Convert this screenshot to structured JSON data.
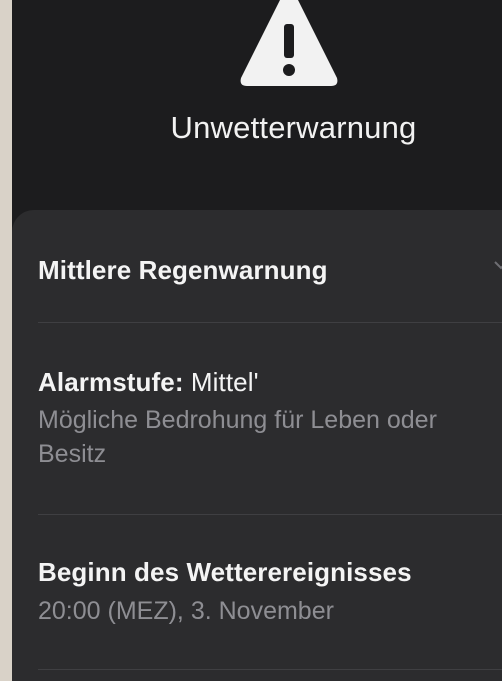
{
  "header": {
    "title": "Unwetterwarnung",
    "icon": "warning-triangle-icon"
  },
  "alert": {
    "name": "Mittlere Regenwarnung",
    "level_label": "Alarmstufe:",
    "level_value": " Mittel'",
    "level_description": "Mögliche Bedrohung für Leben oder Besitz",
    "start_label": "Beginn des Wetterereignisses",
    "start_value": "20:00 (MEZ), 3. November"
  },
  "colors": {
    "background": "#1c1c1e",
    "card": "#2c2c2e",
    "text": "#f4f4f4",
    "secondary_text": "#8e8e93"
  }
}
